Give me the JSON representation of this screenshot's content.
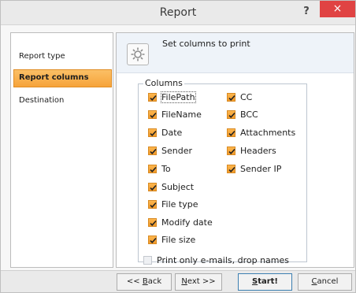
{
  "window": {
    "title": "Report"
  },
  "titlebar": {
    "help_glyph": "?",
    "close_glyph": "×"
  },
  "nav": {
    "items": [
      {
        "label": "Report type"
      },
      {
        "label": "Report columns"
      },
      {
        "label": "Destination"
      }
    ],
    "active": "Report columns"
  },
  "header": {
    "text": "Set columns to print",
    "icon": "gear-icon"
  },
  "columns_group": {
    "legend": "Columns",
    "left": [
      {
        "label": "FilePath",
        "checked": true
      },
      {
        "label": "FileName",
        "checked": true
      },
      {
        "label": "Date",
        "checked": true
      },
      {
        "label": "Sender",
        "checked": true
      },
      {
        "label": "To",
        "checked": true
      },
      {
        "label": "Subject",
        "checked": true
      },
      {
        "label": "File type",
        "checked": true
      },
      {
        "label": "Modify date",
        "checked": true
      },
      {
        "label": "File size",
        "checked": true
      }
    ],
    "right": [
      {
        "label": "CC",
        "checked": true
      },
      {
        "label": "BCC",
        "checked": true
      },
      {
        "label": "Attachments",
        "checked": true
      },
      {
        "label": "Headers",
        "checked": true
      },
      {
        "label": "Sender IP",
        "checked": true
      }
    ]
  },
  "print_only_option": {
    "label": "Print only e-mails, drop names",
    "checked": false
  },
  "buttons": {
    "back_prefix": "<< ",
    "back_key": "B",
    "back_rest": "ack",
    "next_key": "N",
    "next_rest": "ext >>",
    "start_key": "S",
    "start_rest": "tart!",
    "cancel_key": "C",
    "cancel_rest": "ancel"
  },
  "colors": {
    "accent": "#f6a33a",
    "close": "#e04343"
  }
}
